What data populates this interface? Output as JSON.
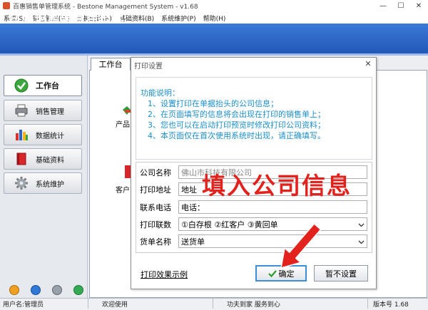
{
  "window": {
    "title": "百惠销售单管理系统 - Bestone Management System - v1.68",
    "controls": [
      "minimize-icon",
      "maximize-icon",
      "close-icon"
    ]
  },
  "menu": [
    "系统(S)",
    "销售管理(W)",
    "数据统计(R)",
    "基础资料(B)",
    "系统维护(P)",
    "帮助(H)"
  ],
  "banner": {
    "title": "百惠销售单管理系统",
    "slogan": "功夫到家 服务到心"
  },
  "sidebar": {
    "items": [
      {
        "label": "工作台",
        "icon": "check-circle-icon",
        "active": true
      },
      {
        "label": "销售管理",
        "icon": "printer-icon"
      },
      {
        "label": "数据统计",
        "icon": "bar-chart-icon"
      },
      {
        "label": "基础资料",
        "icon": "book-icon"
      },
      {
        "label": "系统维护",
        "icon": "gear-icon"
      }
    ],
    "footer_icons": [
      "warning-icon",
      "info-icon",
      "settings-icon",
      "power-icon"
    ]
  },
  "main": {
    "tab": "工作台",
    "shortcuts": [
      {
        "label": "产品",
        "icon": "product-icon"
      },
      {
        "label": "客户",
        "icon": "customer-icon"
      }
    ]
  },
  "dialog": {
    "title": "打印设置",
    "info": {
      "heading": "功能说明：",
      "lines": [
        "1、设置打印在单据抬头的公司信息；",
        "2、在页面填写的信息将会出现在打印的销售单上；",
        "3、您也可以在启动打印预览时修改打印公司资料；",
        "4、本页面仅在首次使用系统时出现，请正确填写。"
      ]
    },
    "fields": [
      {
        "label": "公司名称",
        "value": "佛山市科技有限公司"
      },
      {
        "label": "打印地址",
        "value": "地址"
      },
      {
        "label": "联系电话",
        "value": "电话："
      },
      {
        "label": "打印联数",
        "value": "①白存根 ②红客户 ③黄回单"
      },
      {
        "label": "货单名称",
        "value": "送货单"
      }
    ],
    "overlay_hint": "填入公司信息",
    "example_link": "打印效果示例",
    "ok_label": "确定",
    "skip_label": "暂不设置"
  },
  "status": {
    "user": "用户名:管理员",
    "welcome": "欢迎使用",
    "slogan": "功夫到家 服务到心",
    "version": "版本号 1.68"
  },
  "colors": {
    "banner": "#2a68cc",
    "accent_red": "#e3211d",
    "info_text": "#1b8fc9",
    "ok_border": "#3b8fd8"
  }
}
